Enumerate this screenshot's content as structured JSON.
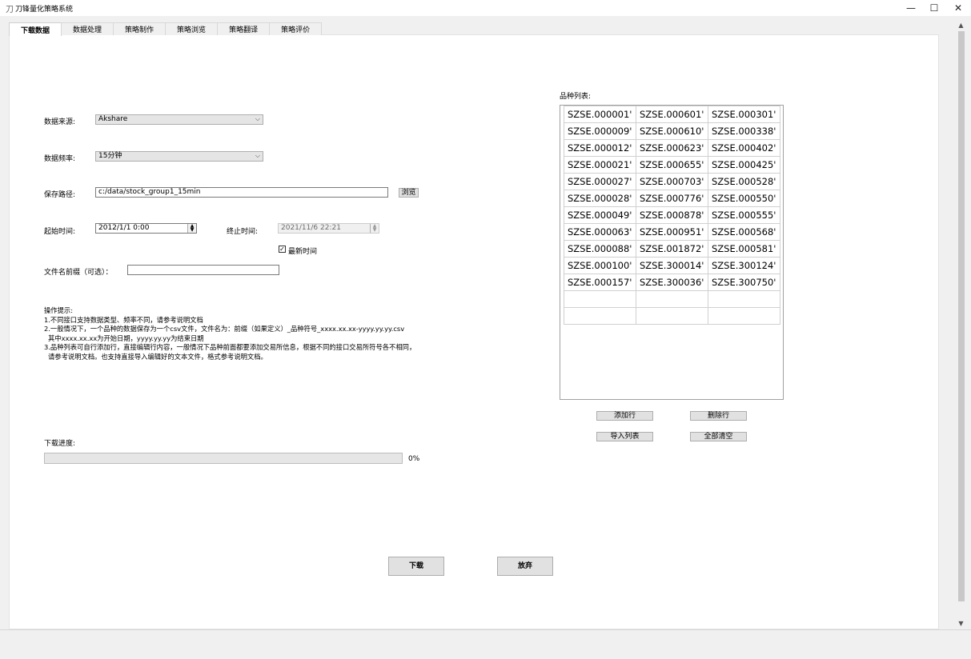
{
  "window": {
    "title": "刀锋量化策略系统",
    "app_icon": "刀",
    "minimize": "—",
    "maximize": "☐",
    "close": "✕"
  },
  "tabs": [
    "下载数据",
    "数据处理",
    "策略制作",
    "策略浏览",
    "策略翻译",
    "策略评价"
  ],
  "active_tab": 0,
  "form": {
    "source_label": "数据来源:",
    "source_value": "Akshare",
    "freq_label": "数据频率:",
    "freq_value": "15分钟",
    "path_label": "保存路径:",
    "path_value": "c:/data/stock_group1_15min",
    "browse_label": "浏览",
    "start_label": "起始时间:",
    "start_value": "2012/1/1 0:00",
    "end_label": "终止时间:",
    "end_value": "2021/11/6 22:21",
    "latest_label": "最新时间",
    "latest_checked": true,
    "prefix_label": "文件名前缀（可选）：",
    "prefix_value": ""
  },
  "hints": {
    "title": "操作提示:",
    "lines": [
      "1.不同接口支持数据类型、频率不同，请参考说明文档",
      "2.一般情况下，一个品种的数据保存为一个csv文件，文件名为：前缀（如果定义）_品种符号_xxxx.xx.xx-yyyy.yy.yy.csv",
      "  其中xxxx.xx.xx为开始日期，yyyy.yy.yy为结束日期",
      "3.品种列表可自行添加行，直接编辑行内容，一般情况下品种前面都要添加交易所信息，根据不同的接口交易所符号各不相同，",
      "  请参考说明文档。也支持直接导入编辑好的文本文件，格式参考说明文档。"
    ]
  },
  "progress": {
    "label": "下载进度:",
    "value_text": "0%",
    "value": 0
  },
  "list": {
    "label": "品种列表:",
    "rows": [
      [
        "SZSE.000001'",
        "SZSE.000601'",
        "SZSE.000301'"
      ],
      [
        "SZSE.000009'",
        "SZSE.000610'",
        "SZSE.000338'"
      ],
      [
        "SZSE.000012'",
        "SZSE.000623'",
        "SZSE.000402'"
      ],
      [
        "SZSE.000021'",
        "SZSE.000655'",
        "SZSE.000425'"
      ],
      [
        "SZSE.000027'",
        "SZSE.000703'",
        "SZSE.000528'"
      ],
      [
        "SZSE.000028'",
        "SZSE.000776'",
        "SZSE.000550'"
      ],
      [
        "SZSE.000049'",
        "SZSE.000878'",
        "SZSE.000555'"
      ],
      [
        "SZSE.000063'",
        "SZSE.000951'",
        "SZSE.000568'"
      ],
      [
        "SZSE.000088'",
        "SZSE.001872'",
        "SZSE.000581'"
      ],
      [
        "SZSE.000100'",
        "SZSE.300014'",
        "SZSE.300124'"
      ],
      [
        "SZSE.000157'",
        "SZSE.300036'",
        "SZSE.300750'"
      ],
      [
        "",
        "",
        ""
      ],
      [
        "",
        "",
        ""
      ]
    ],
    "add_row": "添加行",
    "delete_row": "删除行",
    "import_list": "导入列表",
    "clear_all": "全部清空"
  },
  "actions": {
    "download": "下载",
    "cancel": "放弃"
  },
  "colors": {
    "progress_fill": "#06b025",
    "content_bg": "#ffffff",
    "chrome_bg": "#f0f0f0"
  }
}
